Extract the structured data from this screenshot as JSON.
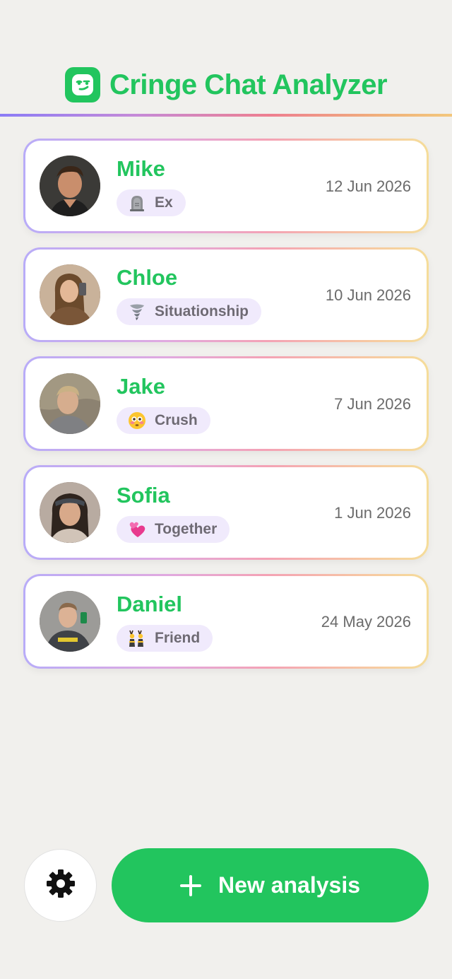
{
  "header": {
    "title": "Cringe Chat Analyzer",
    "logo_icon": "smirk-face-icon"
  },
  "colors": {
    "brand_green": "#22c55e",
    "badge_bg": "#f0eafc",
    "background": "#f1f0ed"
  },
  "chats": [
    {
      "name": "Mike",
      "relation": "Ex",
      "relation_icon": "headstone-icon",
      "date": "12 Jun 2026"
    },
    {
      "name": "Chloe",
      "relation": "Situationship",
      "relation_icon": "tornado-icon",
      "date": "10 Jun 2026"
    },
    {
      "name": "Jake",
      "relation": "Crush",
      "relation_icon": "flushed-face-icon",
      "date": "7 Jun 2026"
    },
    {
      "name": "Sofia",
      "relation": "Together",
      "relation_icon": "two-hearts-icon",
      "date": "1 Jun 2026"
    },
    {
      "name": "Daniel",
      "relation": "Friend",
      "relation_icon": "people-with-bunny-ears-icon",
      "date": "24 May 2026"
    }
  ],
  "actions": {
    "settings_icon": "gear-icon",
    "new_analysis_label": "New analysis"
  }
}
